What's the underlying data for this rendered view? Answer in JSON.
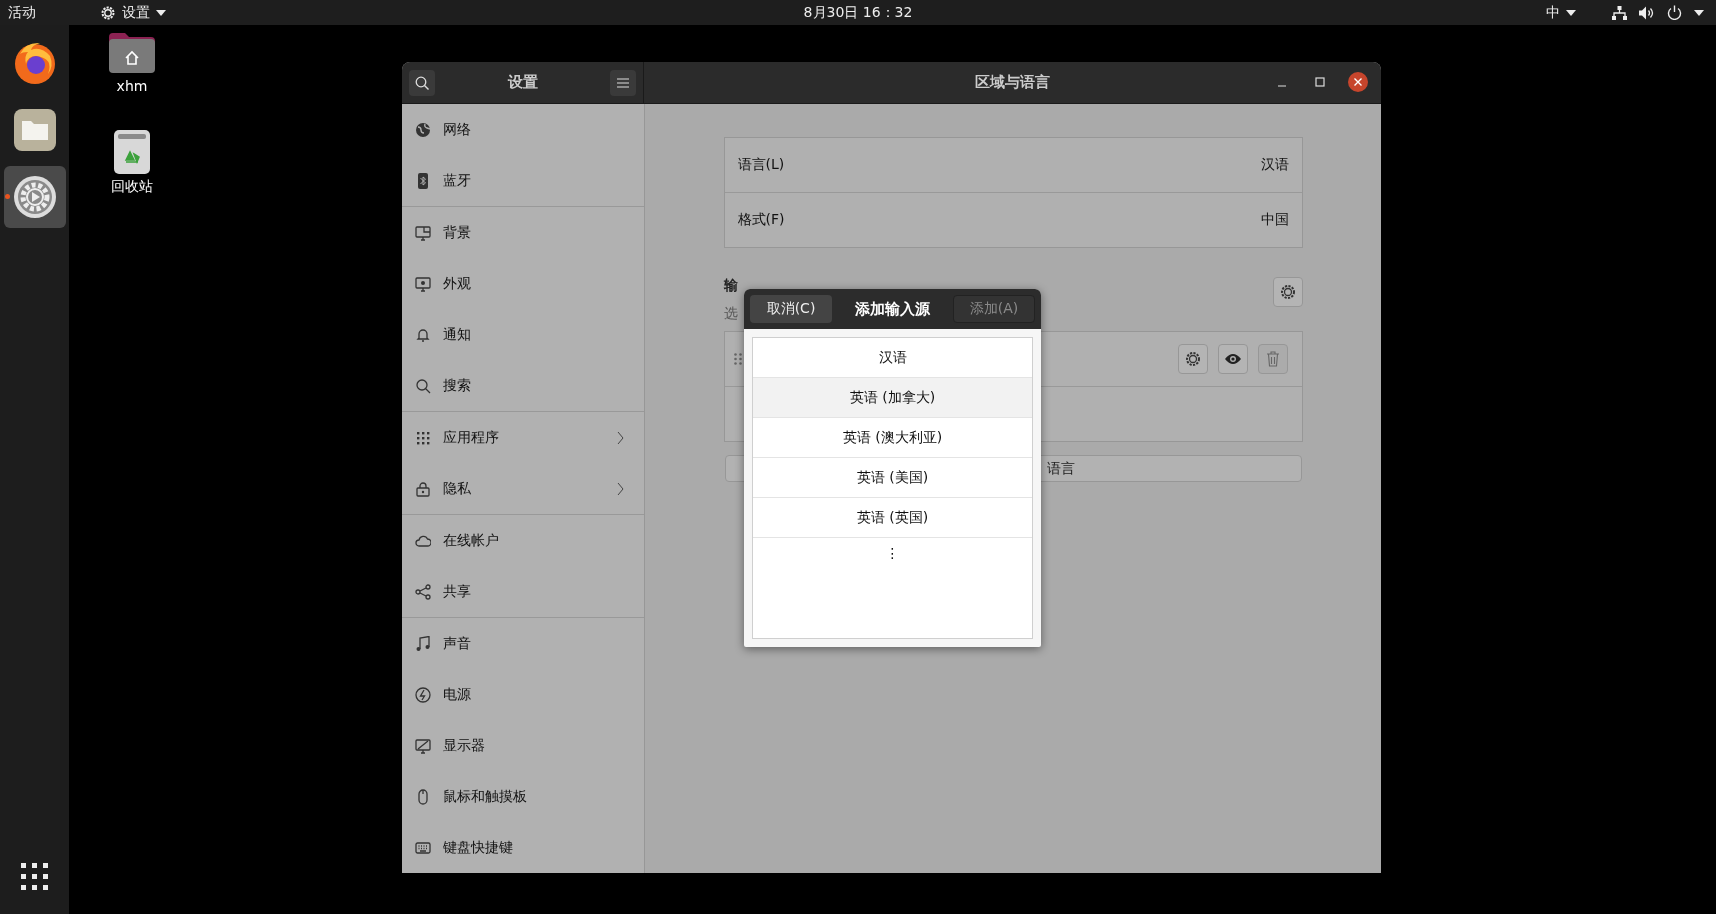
{
  "top_bar": {
    "activities": "活动",
    "app_menu": "设置",
    "clock": "8月30日 16：32",
    "input_method": "中"
  },
  "dock": {
    "items": [
      {
        "kind": "browser",
        "active": false
      },
      {
        "kind": "files",
        "active": false
      },
      {
        "kind": "settings",
        "active": true
      }
    ]
  },
  "desktop_icons": [
    {
      "kind": "folder",
      "label": "xhm"
    },
    {
      "kind": "trash",
      "label": "回收站"
    }
  ],
  "window": {
    "sidebar_title": "设置",
    "title": "区域与语言"
  },
  "sidebar": {
    "groups": [
      {
        "items": [
          {
            "label": "网络",
            "has_submenu": false,
            "selected": false
          },
          {
            "label": "蓝牙",
            "has_submenu": false,
            "selected": false
          }
        ]
      },
      {
        "items": [
          {
            "label": "背景",
            "has_submenu": false,
            "selected": false
          },
          {
            "label": "外观",
            "has_submenu": false,
            "selected": false
          },
          {
            "label": "通知",
            "has_submenu": false,
            "selected": false
          },
          {
            "label": "搜索",
            "has_submenu": false,
            "selected": false
          }
        ]
      },
      {
        "items": [
          {
            "label": "应用程序",
            "has_submenu": true,
            "selected": false
          },
          {
            "label": "隐私",
            "has_submenu": true,
            "selected": false
          }
        ]
      },
      {
        "items": [
          {
            "label": "在线帐户",
            "has_submenu": false,
            "selected": false
          },
          {
            "label": "共享",
            "has_submenu": false,
            "selected": false
          }
        ]
      },
      {
        "items": [
          {
            "label": "声音",
            "has_submenu": false,
            "selected": false
          },
          {
            "label": "电源",
            "has_submenu": false,
            "selected": false
          },
          {
            "label": "显示器",
            "has_submenu": false,
            "selected": false
          },
          {
            "label": "鼠标和触摸板",
            "has_submenu": false,
            "selected": false
          },
          {
            "label": "键盘快捷键",
            "has_submenu": false,
            "selected": false
          }
        ]
      }
    ]
  },
  "language_settings": {
    "rows": [
      {
        "label": "语言(L)",
        "value": "汉语"
      },
      {
        "label": "格式(F)",
        "value": "中国"
      }
    ]
  },
  "input_sources": {
    "heading": "输",
    "subtitle": "选",
    "add_language_button": "语言"
  },
  "dialog": {
    "cancel_button": "取消(C)",
    "title": "添加输入源",
    "add_button": {
      "label": "添加(A)",
      "disabled": true
    },
    "items": [
      {
        "kind": "language",
        "label": "汉语",
        "hovered": false
      },
      {
        "kind": "language",
        "label": "英语 (加拿大)",
        "hovered": true
      },
      {
        "kind": "language",
        "label": "英语 (澳大利亚)",
        "hovered": false
      },
      {
        "kind": "language",
        "label": "英语 (美国)",
        "hovered": false
      },
      {
        "kind": "language",
        "label": "英语 (英国)",
        "hovered": false
      },
      {
        "kind": "more",
        "label": "⋮",
        "hovered": false
      }
    ]
  }
}
